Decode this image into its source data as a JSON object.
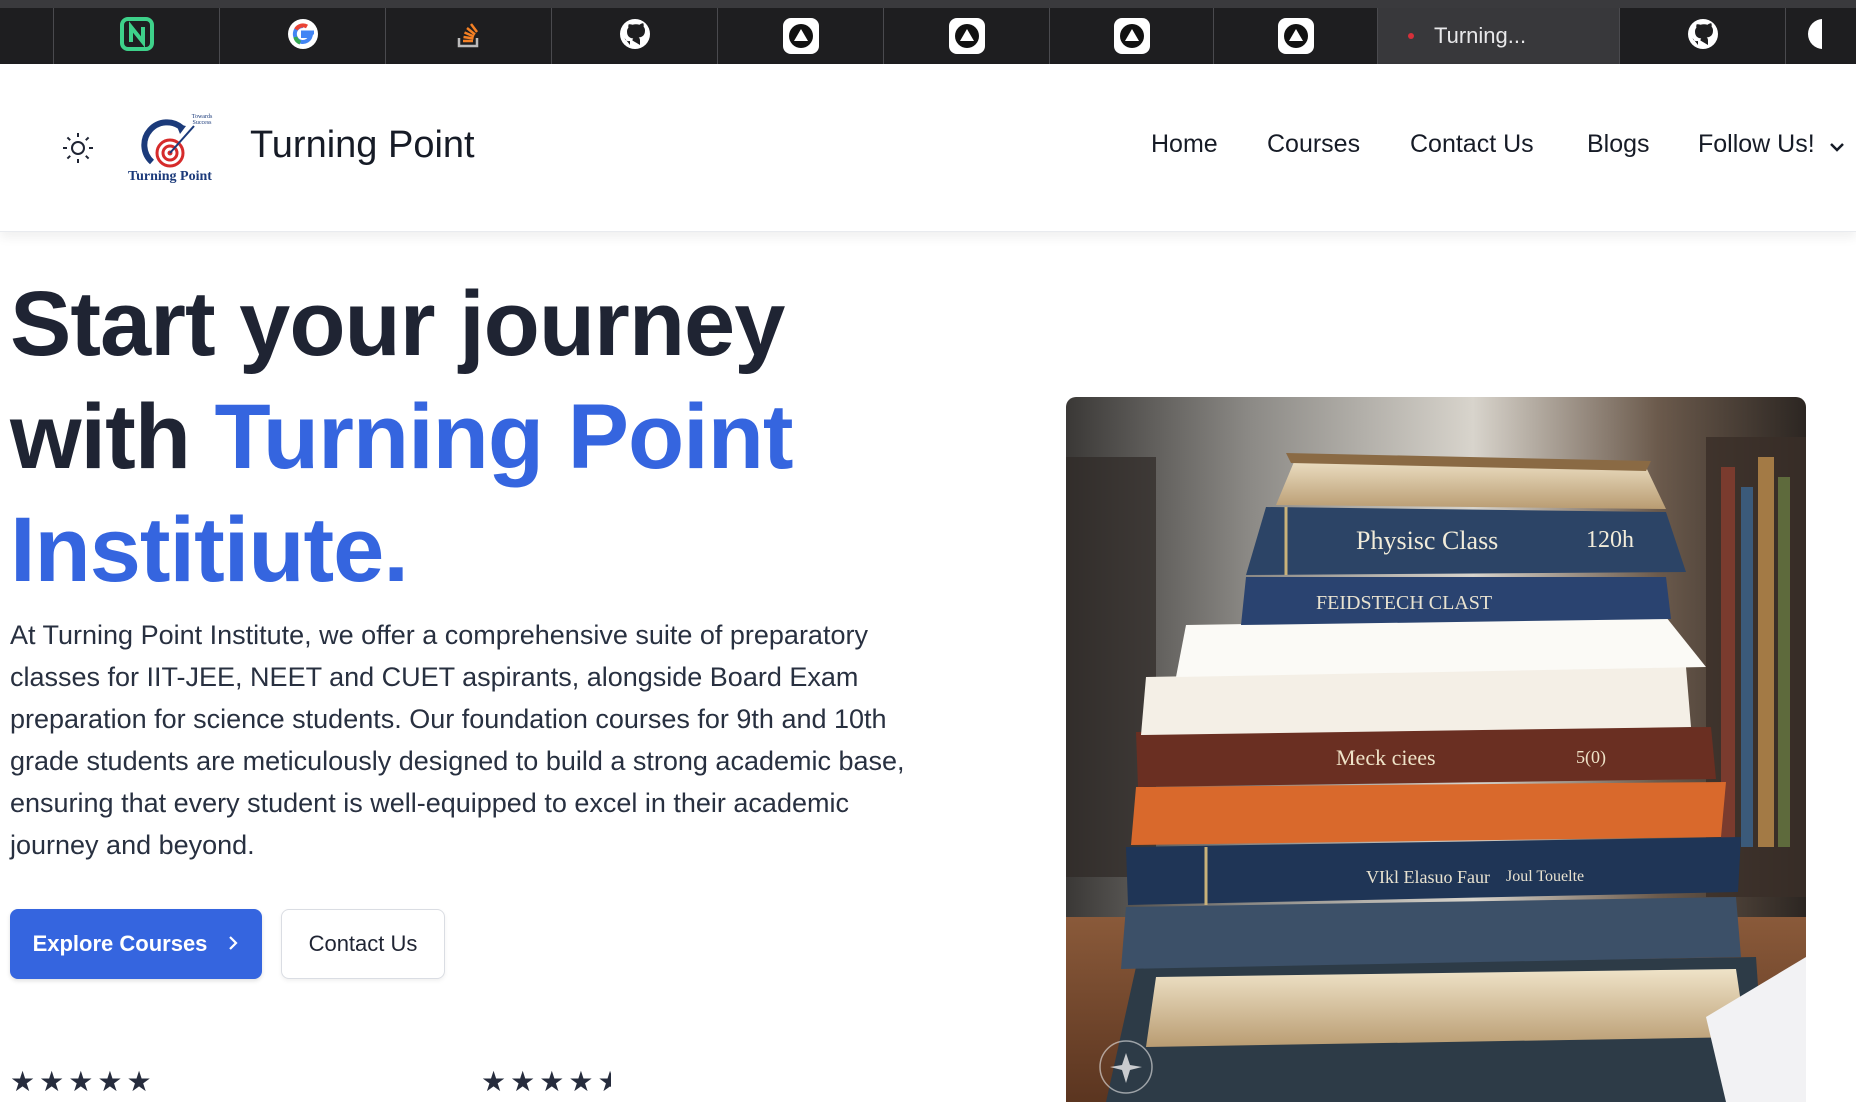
{
  "browser": {
    "tabs": [
      {
        "icon": "notion-like-icon"
      },
      {
        "icon": "google-icon"
      },
      {
        "icon": "stackoverflow-icon"
      },
      {
        "icon": "github-icon"
      },
      {
        "icon": "triangle-app-icon"
      },
      {
        "icon": "triangle-app-icon"
      },
      {
        "icon": "triangle-app-icon"
      },
      {
        "icon": "triangle-app-icon"
      },
      {
        "icon": "turning-point-favicon",
        "title": "Turning..."
      },
      {
        "icon": "github-icon"
      },
      {
        "icon": "github-icon"
      }
    ]
  },
  "header": {
    "theme_toggle_icon": "sun-icon",
    "logo_tagline": "Towards Success",
    "logo_text": "Turning Point",
    "brand": "Turning Point",
    "nav": {
      "home": "Home",
      "courses": "Courses",
      "contact": "Contact Us",
      "blogs": "Blogs",
      "follow": "Follow Us!"
    }
  },
  "hero": {
    "title_line1": "Start your journey",
    "title_with": "with ",
    "title_accent1": "Turning Point",
    "title_accent2": "Institiute.",
    "description": "At Turning Point Institute, we offer a comprehensive suite of preparatory classes for IIT-JEE, NEET and CUET aspirants, alongside Board Exam preparation for science students. Our foundation courses for 9th and 10th grade students are meticulously designed to build a strong academic base, ensuring that every student is well-equipped to excel in their academic journey and beyond.",
    "primary_button": "Explore Courses",
    "secondary_button": "Contact Us",
    "ratings": [
      5,
      4.5
    ],
    "image_book_labels": [
      "Physisc Class",
      "120h",
      "FEIDSTECH CLAST",
      "Meck ciees",
      "5(0)",
      "VIkl Elasuo Faur",
      "Joul Touelte"
    ]
  },
  "colors": {
    "accent": "#3565df",
    "text": "#1f2433",
    "tabstrip": "#1e1e20"
  }
}
